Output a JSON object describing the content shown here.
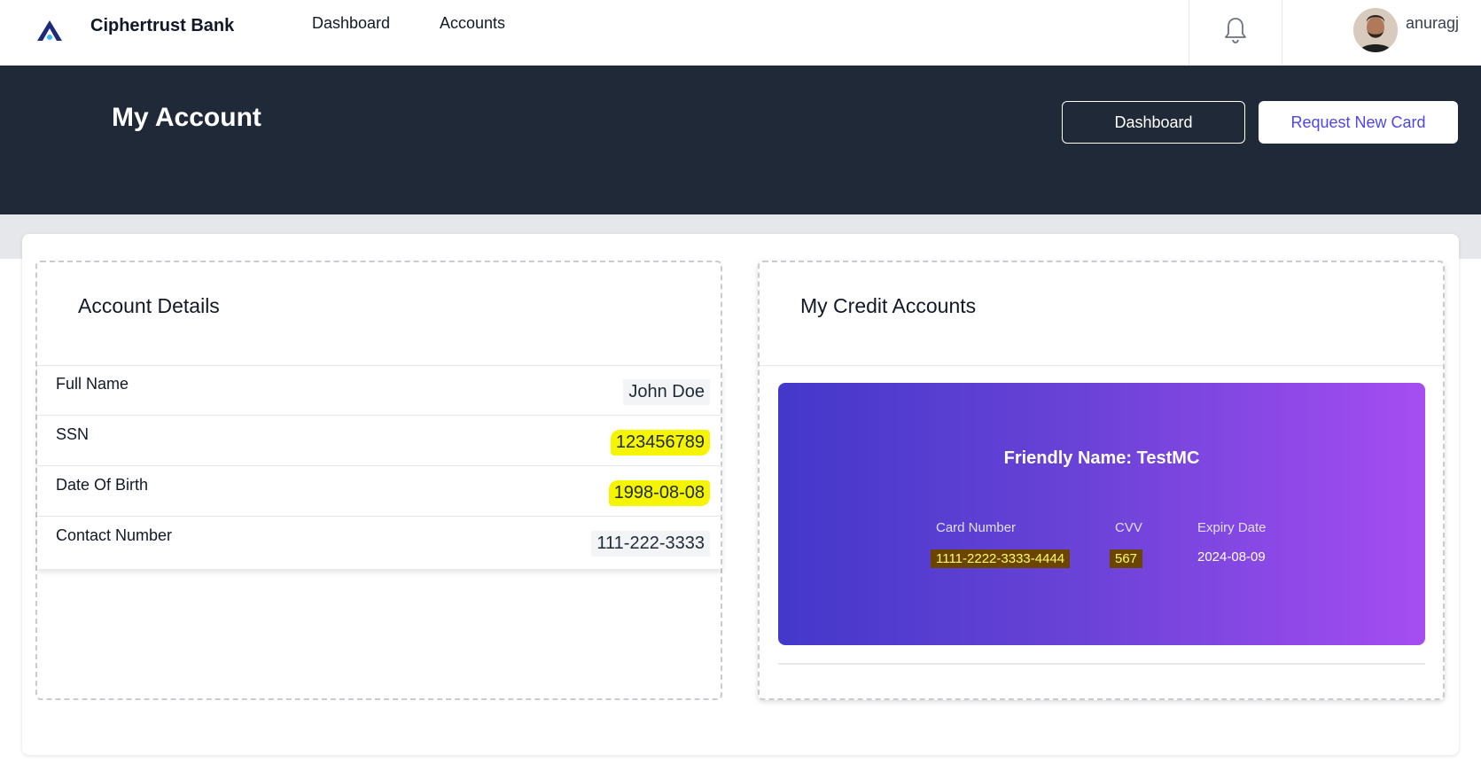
{
  "brand": {
    "name": "Ciphertrust Bank",
    "logo_icon": "brand-logo-icon"
  },
  "nav": {
    "links": [
      "Dashboard",
      "Accounts"
    ],
    "notification_icon": "bell-icon",
    "user": {
      "name": "anuragj",
      "avatar_icon": "user-avatar"
    }
  },
  "header": {
    "title": "My Account",
    "dashboard_button": "Dashboard",
    "request_card_button": "Request New Card"
  },
  "account_details": {
    "title": "Account Details",
    "rows": [
      {
        "label": "Full Name",
        "value": "John Doe",
        "highlighted": false
      },
      {
        "label": "SSN",
        "value": "123456789",
        "highlighted": true
      },
      {
        "label": "Date Of Birth",
        "value": "1998-08-08",
        "highlighted": true
      },
      {
        "label": "Contact Number",
        "value": "111-222-3333",
        "highlighted": false
      }
    ]
  },
  "credit_accounts": {
    "title": "My Credit Accounts",
    "card": {
      "friendly_name": "Friendly Name: TestMC",
      "card_number_label": "Card Number",
      "card_number": "1111-2222-3333-4444",
      "cvv_label": "CVV",
      "cvv": "567",
      "expiry_label": "Expiry Date",
      "expiry": "2024-08-09"
    }
  },
  "colors": {
    "header_bg": "#1f2937",
    "accent": "#4f46e5",
    "card_gradient_start": "#4338ca",
    "card_gradient_end": "#a64df2",
    "highlight": "#f5f500"
  }
}
